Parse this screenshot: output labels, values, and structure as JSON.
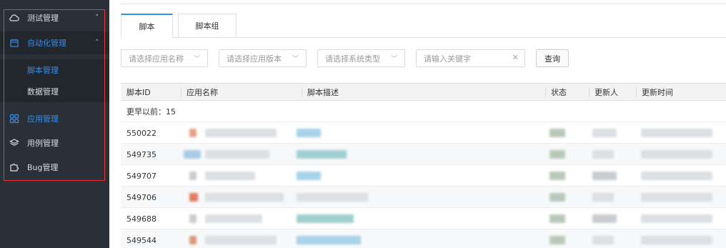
{
  "sidebar": {
    "items": [
      {
        "label": "测试管理",
        "icon": "cloud-icon",
        "chevron": "˅"
      },
      {
        "label": "自动化管理",
        "icon": "calendar-icon",
        "chevron": "˄"
      },
      {
        "label": "应用管理",
        "icon": "grid-icon"
      },
      {
        "label": "用例管理",
        "icon": "layers-icon"
      },
      {
        "label": "Bug管理",
        "icon": "puzzle-icon"
      }
    ],
    "sub_items": [
      {
        "label": "脚本管理"
      },
      {
        "label": "数据管理"
      }
    ]
  },
  "tabs": [
    {
      "label": "脚本"
    },
    {
      "label": "脚本组"
    }
  ],
  "filters": {
    "app_name_placeholder": "请选择应用名称",
    "app_version_placeholder": "请选择应用版本",
    "system_type_placeholder": "请选择系统类型",
    "keyword_placeholder": "请输入关键字",
    "search_button": "查询"
  },
  "table": {
    "headers": {
      "id": "脚本ID",
      "app_name": "应用名称",
      "description": "脚本描述",
      "status": "状态",
      "updater": "更新人",
      "update_time": "更新时间"
    },
    "group_label": "更早以前：15",
    "rows": [
      {
        "id": "550022"
      },
      {
        "id": "549735"
      },
      {
        "id": "549707"
      },
      {
        "id": "549706"
      },
      {
        "id": "549688"
      },
      {
        "id": "549544"
      }
    ]
  },
  "colors": {
    "sidebar_bg": "#2b3038",
    "accent": "#3a8ee6",
    "highlight_border": "#e8383d"
  }
}
